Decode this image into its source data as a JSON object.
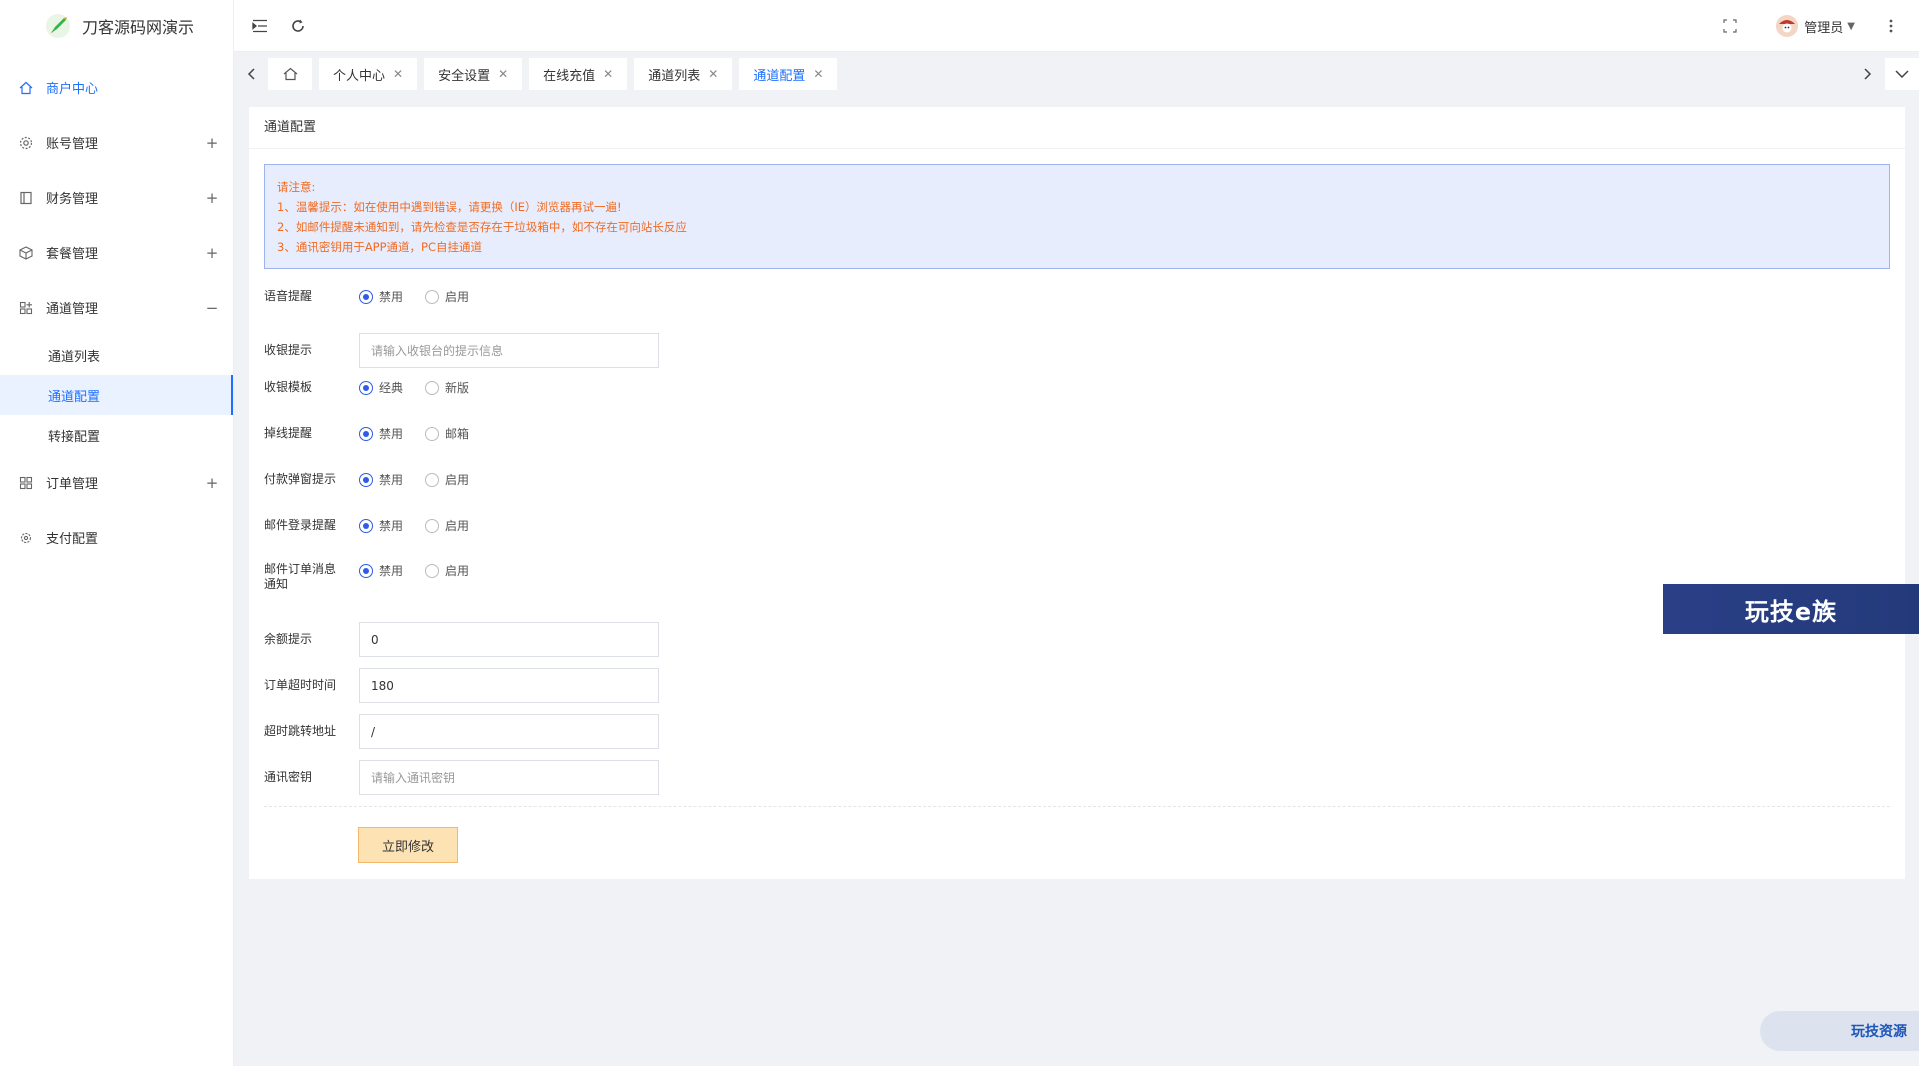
{
  "app": {
    "title": "刀客源码网演示"
  },
  "sidebar": {
    "items": [
      {
        "label": "商户中心",
        "icon": "home-icon",
        "active": true,
        "toggle": ""
      },
      {
        "label": "账号管理",
        "icon": "gear-icon",
        "toggle": "+"
      },
      {
        "label": "财务管理",
        "icon": "ledger-icon",
        "toggle": "+"
      },
      {
        "label": "套餐管理",
        "icon": "package-icon",
        "toggle": "+"
      },
      {
        "label": "通道管理",
        "icon": "channel-icon",
        "toggle": "−"
      }
    ],
    "submenu": [
      {
        "label": "通道列表"
      },
      {
        "label": "通道配置",
        "active": true
      },
      {
        "label": "转接配置"
      }
    ],
    "items_after": [
      {
        "label": "订单管理",
        "icon": "apps-icon",
        "toggle": "+"
      },
      {
        "label": "支付配置",
        "icon": "settings-icon",
        "toggle": ""
      }
    ]
  },
  "header": {
    "user": "管理员"
  },
  "tabs": [
    {
      "label": "个人中心"
    },
    {
      "label": "安全设置"
    },
    {
      "label": "在线充值"
    },
    {
      "label": "通道列表"
    },
    {
      "label": "通道配置",
      "active": true
    }
  ],
  "card": {
    "title": "通道配置",
    "notice": [
      "请注意:",
      "1、温馨提示：如在使用中遇到错误，请更换（IE）浏览器再试一遍!",
      "2、如邮件提醒未通知到，请先检查是否存在于垃圾箱中，如不存在可向站长反应",
      "3、通讯密钥用于APP通道，PC自挂通道"
    ]
  },
  "form": {
    "voice": {
      "label": "语音提醒",
      "options": [
        "禁用",
        "启用"
      ],
      "checked": 0
    },
    "cashier_tip": {
      "label": "收银提示",
      "placeholder": "请输入收银台的提示信息",
      "value": ""
    },
    "cashier_template": {
      "label": "收银模板",
      "options": [
        "经典",
        "新版"
      ],
      "checked": 0
    },
    "offline": {
      "label": "掉线提醒",
      "options": [
        "禁用",
        "邮箱"
      ],
      "checked": 0
    },
    "pay_popup": {
      "label": "付款弹窗提示",
      "options": [
        "禁用",
        "启用"
      ],
      "checked": 0
    },
    "mail_login": {
      "label": "邮件登录提醒",
      "options": [
        "禁用",
        "启用"
      ],
      "checked": 0
    },
    "mail_order": {
      "label": "邮件订单消息通知",
      "options": [
        "禁用",
        "启用"
      ],
      "checked": 0
    },
    "balance": {
      "label": "余额提示",
      "value": "0"
    },
    "timeout": {
      "label": "订单超时时间",
      "value": "180"
    },
    "redirect": {
      "label": "超时跳转地址",
      "value": "/"
    },
    "secret": {
      "label": "通讯密钥",
      "placeholder": "请输入通讯密钥",
      "value": ""
    },
    "submit": "立即修改"
  },
  "watermarks": {
    "badge": "玩技e族",
    "bottom": "玩技资源"
  },
  "colors": {
    "accent": "#1e6fff",
    "notice_text": "#f06b21",
    "notice_bg": "#e8edfd",
    "radio_checked": "#2f5be6",
    "submit_bg": "#fde2b3"
  }
}
